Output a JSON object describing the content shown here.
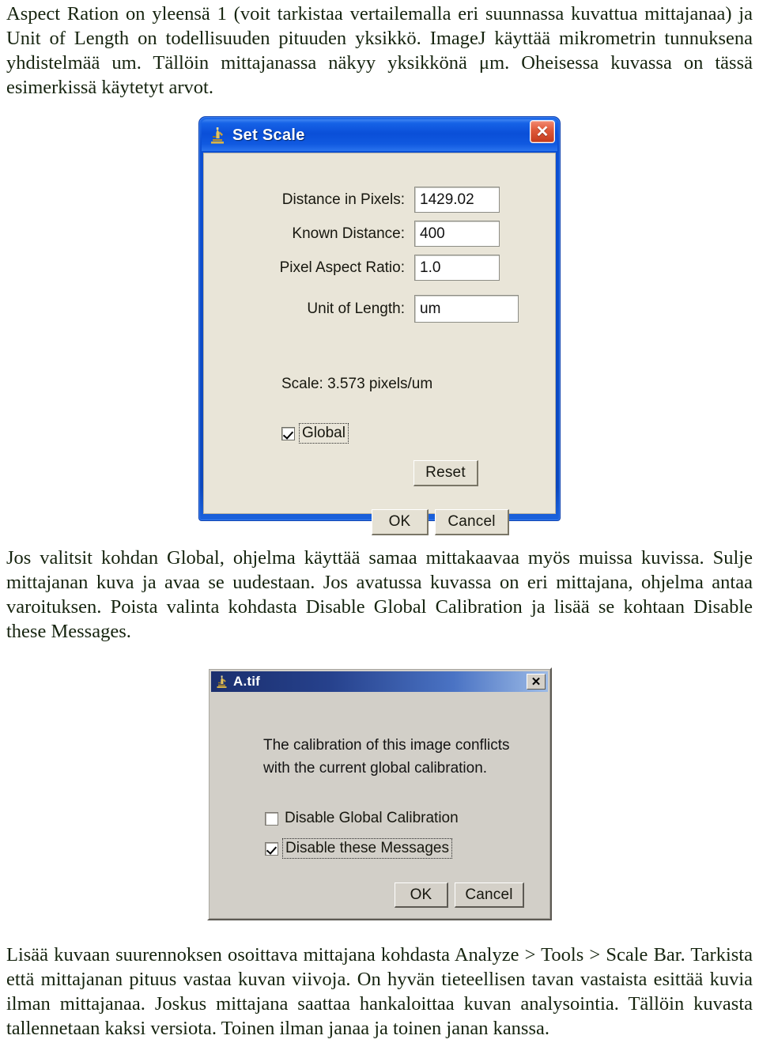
{
  "document": {
    "paragraph_top": "Aspect Ration on yleensä 1 (voit tarkistaa vertailemalla eri suunnassa kuvattua mittajanaa) ja Unit of Length on todellisuuden pituuden yksikkö. ImageJ käyttää mikrometrin tunnuksena yhdistelmää um. Tällöin mittajanassa näkyy yksikkönä μm. Oheisessa kuvassa on tässä esimerkissä käytetyt arvot.",
    "paragraph_middle": "Jos valitsit kohdan Global, ohjelma käyttää samaa mittakaavaa myös muissa kuvissa. Sulje mittajanan kuva ja avaa se uudestaan. Jos avatussa kuvassa on eri mittajana, ohjelma antaa varoituksen. Poista valinta kohdasta Disable Global Calibration ja lisää se kohtaan Disable these Messages.",
    "paragraph_bottom": "Lisää kuvaan suurennoksen osoittava mittajana kohdasta Analyze > Tools > Scale Bar. Tarkista että mittajanan pituus vastaa kuvan viivoja. On hyvän tieteellisen tavan vastaista esittää kuvia ilman mittajanaa. Joskus mittajana saattaa hankaloittaa kuvan analysointia. Tällöin kuvasta tallennetaan kaksi versiota. Toinen ilman janaa ja toinen janan kanssa."
  },
  "set_scale_dialog": {
    "title": "Set Scale",
    "title_icon": "microscope-icon",
    "close_icon": "close-icon",
    "close_glyph": "✕",
    "fields": [
      {
        "label": "Distance in Pixels:",
        "value": "1429.02"
      },
      {
        "label": "Known Distance:",
        "value": "400"
      },
      {
        "label": "Pixel Aspect Ratio:",
        "value": "1.0"
      },
      {
        "label": "Unit of Length:",
        "value": "um"
      }
    ],
    "scale_note": "Scale: 3.573 pixels/um",
    "global_checkbox": {
      "label": "Global",
      "checked": true
    },
    "reset_button": "Reset",
    "ok_button": "OK",
    "cancel_button": "Cancel",
    "colors": {
      "titlebar_blue": "#0a4fd6",
      "close_red": "#c43a1c",
      "client_bg": "#e9e5d8"
    }
  },
  "atif_dialog": {
    "title": "A.tif",
    "title_icon": "microscope-icon",
    "close_icon": "close-icon",
    "close_glyph": "✕",
    "message_line_1": "The calibration of this image conflicts",
    "message_line_2": "with the current global calibration.",
    "checkboxes": [
      {
        "label": "Disable Global Calibration",
        "checked": false,
        "focused": false
      },
      {
        "label": "Disable these Messages",
        "checked": true,
        "focused": true
      }
    ],
    "ok_button": "OK",
    "cancel_button": "Cancel",
    "colors": {
      "titlebar_navy": "#1b2f6e",
      "titlebar_light": "#9dbbe6",
      "client_bg": "#d2cfc8"
    }
  }
}
